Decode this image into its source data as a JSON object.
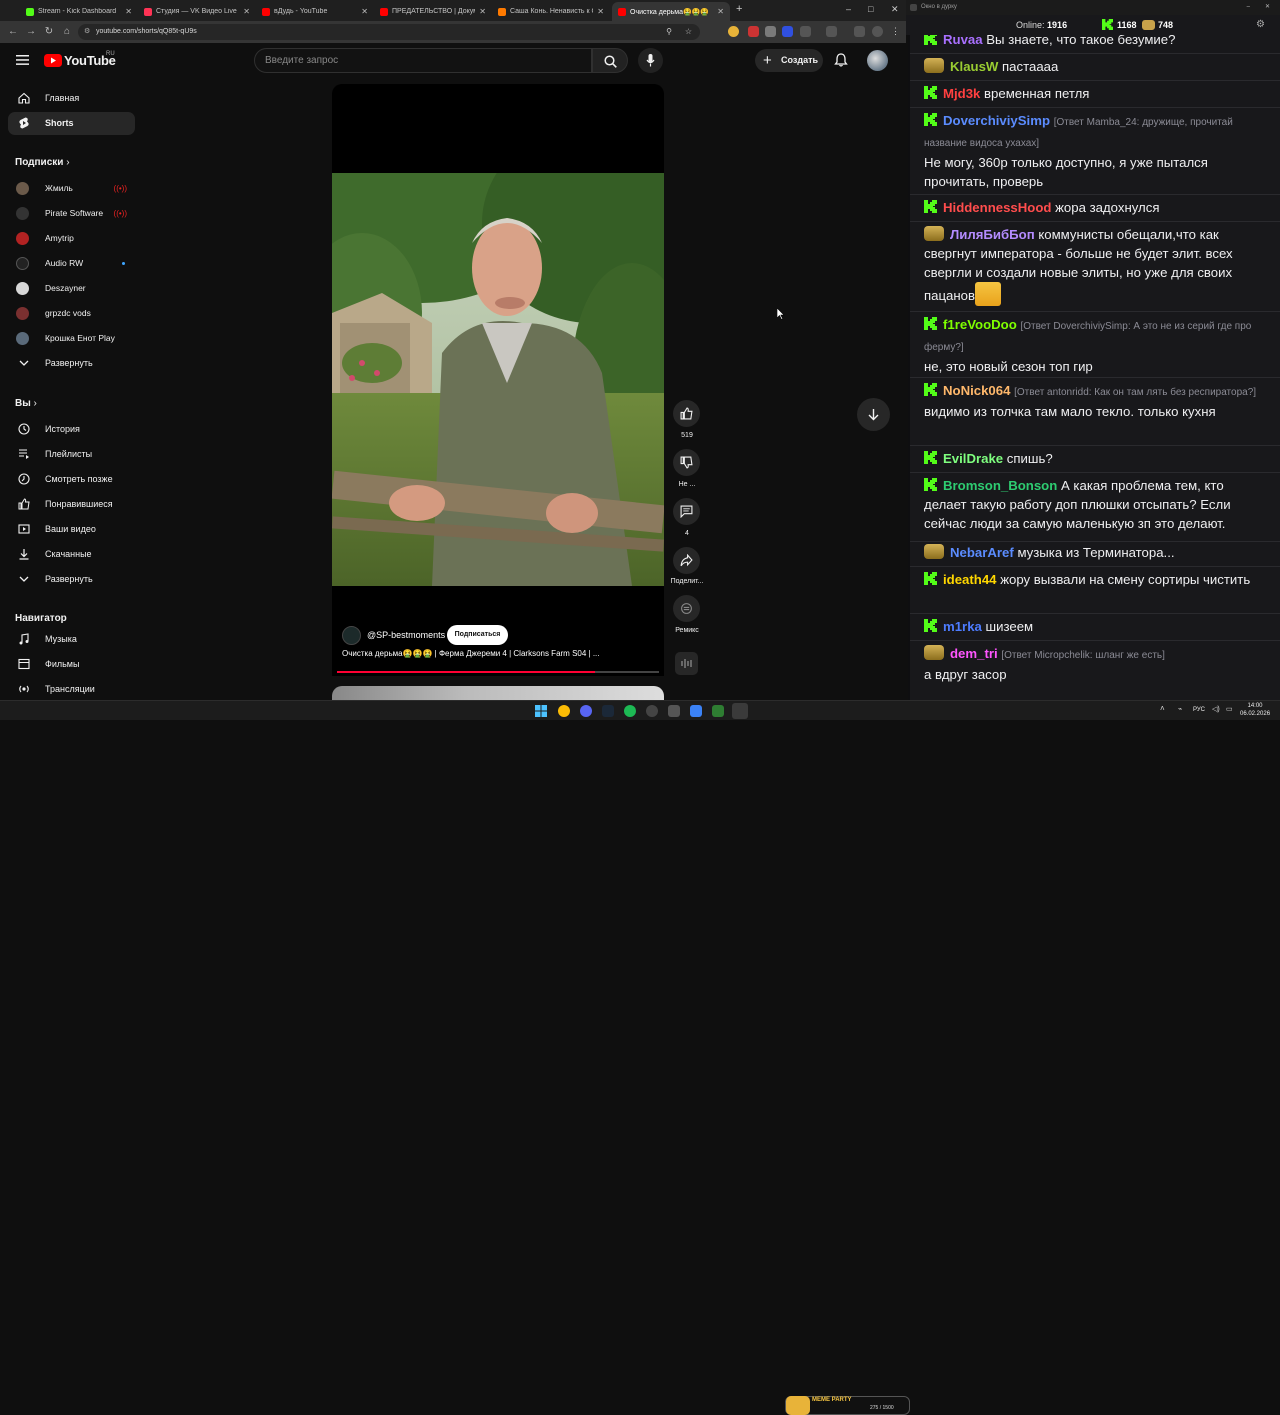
{
  "browser": {
    "tabs": [
      {
        "label": "Stream - Kick Dashboard",
        "color": "#53fc18"
      },
      {
        "label": "Студия — VK Видео Live",
        "color": "#ff3355"
      },
      {
        "label": "вДудь - YouTube",
        "color": "#ff0000"
      },
      {
        "label": "ПРЕДАТЕЛЬСТВО | Документальный",
        "color": "#ff0000"
      },
      {
        "label": "Саша Конь. Ненависть к Стас",
        "color": "#ff7a00"
      },
      {
        "label": "Очистка дерьма🤮🤮🤮",
        "color": "#ff0000"
      }
    ],
    "new_tab": "+",
    "url": "youtube.com/shorts/qQ85t-qU9s",
    "window_controls": [
      "–",
      "□",
      "✕"
    ]
  },
  "youtube": {
    "logo": "YouTube",
    "logo_region": "RU",
    "search_placeholder": "Введите запрос",
    "create_label": "Создать",
    "nav": [
      {
        "label": "Главная",
        "icon": "home-icon"
      },
      {
        "label": "Shorts",
        "icon": "shorts-icon"
      }
    ],
    "subscriptions_title": "Подписки",
    "subscriptions": [
      {
        "label": "Жмиль",
        "live": true,
        "color": "#6b5a4a"
      },
      {
        "label": "Pirate Software",
        "live": true,
        "color": "#333333"
      },
      {
        "label": "Amytrip",
        "live": false,
        "color": "#b22222"
      },
      {
        "label": "Audio RW",
        "live": false,
        "new": true,
        "color": "#222222"
      },
      {
        "label": "Deszayner",
        "live": false,
        "color": "#d8d8d8"
      },
      {
        "label": "grpzdc vods",
        "live": false,
        "color": "#7a3030"
      },
      {
        "label": "Крошка Енот Play",
        "live": false,
        "color": "#5a6a7a"
      }
    ],
    "expand_label": "Развернуть",
    "you_title": "Вы",
    "you_items": [
      {
        "label": "История",
        "icon": "history-icon"
      },
      {
        "label": "Плейлисты",
        "icon": "playlists-icon"
      },
      {
        "label": "Смотреть позже",
        "icon": "watch-later-icon"
      },
      {
        "label": "Понравившиеся",
        "icon": "like-icon"
      },
      {
        "label": "Ваши видео",
        "icon": "your-videos-icon"
      },
      {
        "label": "Скачанные",
        "icon": "download-icon"
      },
      {
        "label": "Развернуть",
        "icon": "chevron-down-icon"
      }
    ],
    "navigator_title": "Навигатор",
    "navigator_items": [
      {
        "label": "Музыка",
        "icon": "music-icon"
      },
      {
        "label": "Фильмы",
        "icon": "film-icon"
      },
      {
        "label": "Трансляции",
        "icon": "live-icon"
      }
    ],
    "short": {
      "channel": "@SP-bestmoments",
      "subscribe": "Подписаться",
      "title": "Очистка дерьма🤮🤮🤮 | Ферма Джереми 4 | Clarksons Farm S04 | ...",
      "progress": 0.8
    },
    "actions": {
      "likes": "519",
      "dislike": "Не ...",
      "comments": "4",
      "share": "Поделит...",
      "remix": "Ремикс"
    }
  },
  "chat": {
    "window_title": "Окно в дурку",
    "online_label": "Online:",
    "online": "1916",
    "kick_count": "1168",
    "other_count": "748",
    "messages": [
      {
        "user": "Ruvaa",
        "color": "#a970ff",
        "badge": "kick",
        "text": "Вы знаете, что такое безумие?"
      },
      {
        "user": "KlausW",
        "color": "#9acd32",
        "badge": "pepe",
        "text": "пастаааа"
      },
      {
        "user": "Mjd3k",
        "color": "#ff4040",
        "badge": "kick",
        "text": "временная петля"
      },
      {
        "user": "DoverchiviySimp",
        "color": "#5b8cff",
        "badge": "kick",
        "reply": "[Ответ Mamba_24: дружище, прочитай название видоса ухахах]",
        "text": "Не могу, 360р только доступно, я уже пытался прочитать, проверь"
      },
      {
        "user": "HiddennessHood",
        "color": "#ff4d4d",
        "badge": "kick",
        "text": "жора задохнулся"
      },
      {
        "user": "ЛиляБибБоп",
        "color": "#b48cff",
        "badge": "pepe",
        "text": "коммунисты обещали,что как свергнут императора - больше не будет элит. всех свергли и создали новые элиты, но уже для своих пацанов",
        "emote": true
      },
      {
        "user": "f1reVooDoo",
        "color": "#7fff00",
        "badge": "kick",
        "reply": "[Ответ DoverchiviySimp: А это не из серий где про ферму?]",
        "text": "не, это новый сезон топ гир"
      },
      {
        "user": "NoNick064",
        "color": "#ffb86b",
        "badge": "kick",
        "reply": "[Ответ antonridd: Как он там лять без респиратора?]",
        "text": "видимо из толчка там мало текло. только кухня"
      },
      {
        "user": "EvilDrake",
        "color": "#7fff7f",
        "badge": "kick",
        "text": "спишь?"
      },
      {
        "user": "Bromson_Bonson",
        "color": "#2ecc71",
        "badge": "kick",
        "text": "А какая проблема тем, кто делает такую работу доп плюшки отсыпать? Если сейчас люди за самую маленькую зп это делают."
      },
      {
        "user": "NebarAref",
        "color": "#5b8cff",
        "badge": "pepe",
        "text": "музыка из Терминатора..."
      },
      {
        "user": "ideath44",
        "color": "#ffd700",
        "badge": "kick",
        "text": "жору вызвали на смену сортиры чистить"
      },
      {
        "user": "m1rka",
        "color": "#4d7cff",
        "badge": "kick",
        "text": "шизеем"
      },
      {
        "user": "dem_tri",
        "color": "#ff55ff",
        "badge": "pepe",
        "reply": "[Ответ Micropchelik: шланг же есть]",
        "text": "а вдруг засор"
      }
    ]
  },
  "taskbar": {
    "widget_label": "MEME PARTY",
    "widget_counter": "275 / 1500",
    "lang": "РУС",
    "time": "14:00",
    "date": "06.02.2026"
  }
}
